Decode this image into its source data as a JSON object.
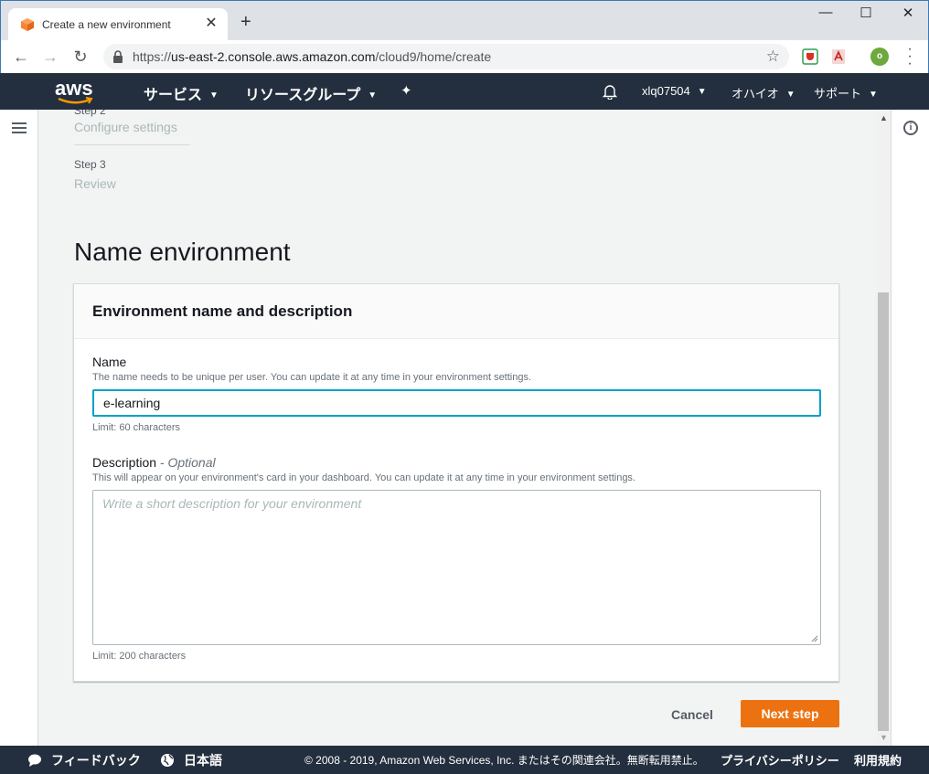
{
  "browser": {
    "tab_title": "Create a new environment",
    "url_scheme": "https://",
    "url_host": "us-east-2.console.aws.amazon.com",
    "url_path": "/cloud9/home/create",
    "profile_initial": "o"
  },
  "aws_nav": {
    "logo_text": "aws",
    "services_label": "サービス",
    "resource_groups_label": "リソースグループ",
    "account_label": "xlq07504",
    "region_label": "オハイオ",
    "support_label": "サポート"
  },
  "steps": [
    {
      "label": "Step 2",
      "name": "Configure settings"
    },
    {
      "label": "Step 3",
      "name": "Review"
    }
  ],
  "page": {
    "title": "Name environment",
    "panel_title": "Environment name and description",
    "name_label": "Name",
    "name_hint": "The name needs to be unique per user. You can update it at any time in your environment settings.",
    "name_value": "e-learning",
    "name_limit": "Limit: 60 characters",
    "description_label": "Description",
    "description_optional": "- Optional",
    "description_hint": "This will appear on your environment's card in your dashboard. You can update it at any time in your environment settings.",
    "description_placeholder": "Write a short description for your environment",
    "description_limit": "Limit: 200 characters",
    "cancel_label": "Cancel",
    "next_label": "Next step"
  },
  "footer": {
    "feedback_label": "フィードバック",
    "language_label": "日本語",
    "copyright": "© 2008 - 2019, Amazon Web Services, Inc. またはその関連会社。無断転用禁止。",
    "privacy_label": "プライバシーポリシー",
    "terms_label": "利用規約"
  },
  "colors": {
    "aws_nav_bg": "#232f3e",
    "primary_button": "#ec7211",
    "input_focus": "#00a1c9"
  },
  "icons": [
    "cube-favicon",
    "close-icon",
    "plus-icon",
    "back-arrow-icon",
    "forward-arrow-icon",
    "reload-icon",
    "lock-icon",
    "star-icon",
    "bell-icon",
    "pin-icon",
    "hamburger-icon",
    "info-icon",
    "feedback-bubble-icon",
    "globe-icon"
  ]
}
